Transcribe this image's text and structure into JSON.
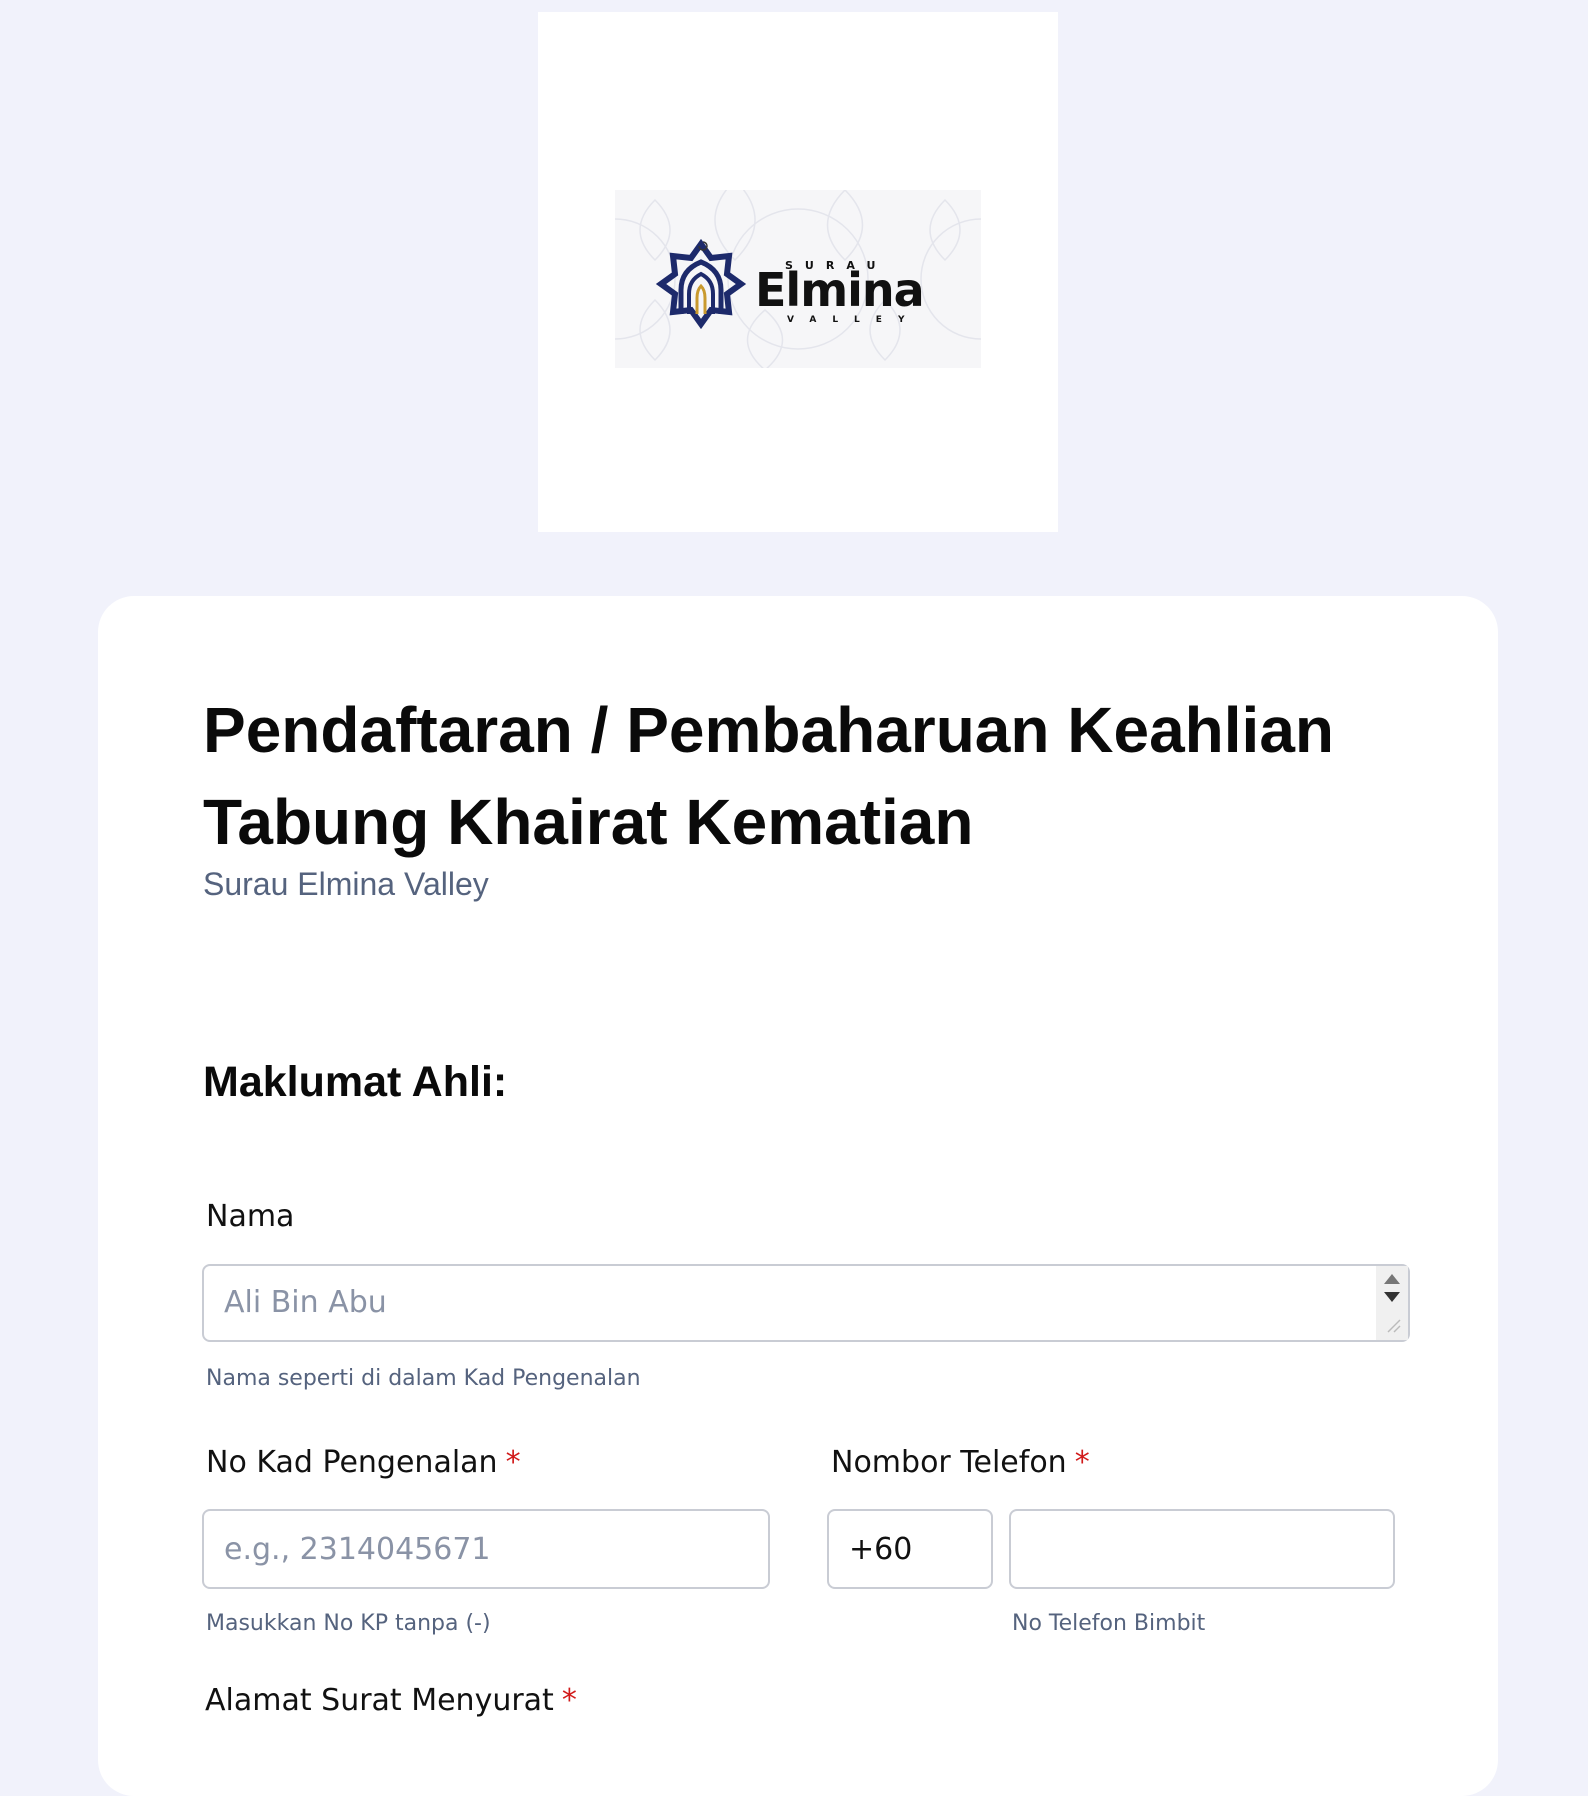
{
  "logo": {
    "top_text": "SURAU",
    "main_text": "Elmina",
    "bottom_text": "VALLEY"
  },
  "form": {
    "title": "Pendaftaran / Pembaharuan Keahlian Tabung Khairat Kematian",
    "subtitle": "Surau Elmina Valley",
    "section_heading": "Maklumat Ahli:"
  },
  "fields": {
    "nama": {
      "label": "Nama",
      "placeholder": "Ali Bin Abu",
      "helper": "Nama seperti di dalam Kad Pengenalan"
    },
    "no_kp": {
      "label": "No Kad Pengenalan",
      "required_mark": "*",
      "placeholder": "e.g., 2314045671",
      "helper": "Masukkan No KP tanpa (-)"
    },
    "telefon": {
      "label": "Nombor Telefon",
      "required_mark": "*",
      "country_code": "+60",
      "value": "",
      "helper": "No Telefon Bimbit"
    },
    "alamat": {
      "label": "Alamat Surat Menyurat",
      "required_mark": "*"
    }
  },
  "colors": {
    "page_bg": "#f1f2fb",
    "card_bg": "#ffffff",
    "required": "#d11a1a",
    "muted_text": "#55637e",
    "logo_blue": "#1d2a6b",
    "logo_gold": "#c99a2e"
  }
}
